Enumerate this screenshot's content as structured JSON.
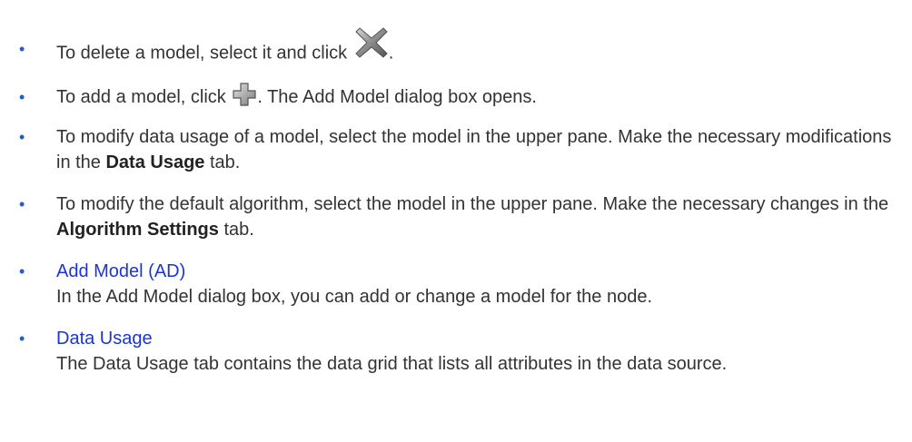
{
  "items": [
    {
      "bullet": "•",
      "before": "To delete a model, select it and click ",
      "after": ".",
      "icon": "delete-x-icon"
    },
    {
      "bullet": "•",
      "before": "To add a model, click ",
      "after": ". The Add Model dialog box opens.",
      "icon": "add-plus-icon"
    },
    {
      "bullet": "•",
      "before": "To modify data usage of a model, select the model in the upper pane. Make the necessary modifications in the ",
      "bold": "Data Usage",
      "after": " tab."
    },
    {
      "bullet": "•",
      "before": "To modify the default algorithm, select the model in the upper pane. Make the necessary changes in the ",
      "bold": "Algorithm Settings",
      "after": " tab."
    },
    {
      "bullet": "•",
      "link": "Add Model (AD)",
      "desc": "In the Add Model dialog box, you can add or change a model for the node."
    },
    {
      "bullet": "•",
      "link": "Data Usage",
      "desc": "The Data Usage tab contains the data grid that lists all attributes in the data source."
    }
  ],
  "colors": {
    "text": "#333333",
    "bullet": "#1f5fbf",
    "link": "#1a35d6"
  }
}
